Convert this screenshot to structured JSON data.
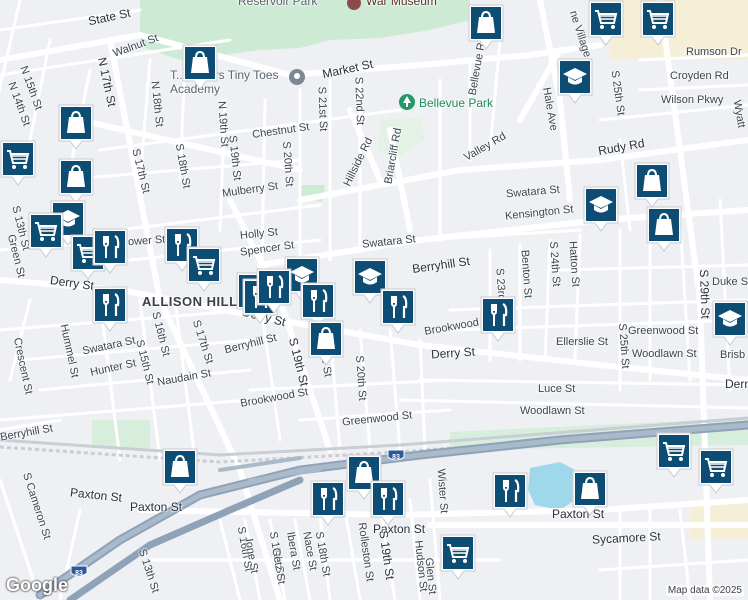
{
  "map": {
    "attribution": "Map data ©2025",
    "logo": "Google",
    "colors": {
      "land": "#eef0f3",
      "park": "#cdebd4",
      "water": "#9fd8ea",
      "sand": "#f6efd8",
      "road": "#ffffff",
      "highway": "#8fa2b8",
      "rail": "#c9cdd4",
      "marker": "#0e4d73"
    }
  },
  "labels": {
    "state_st": "State St",
    "walnut_st": "Walnut St",
    "n15th": "N 15th St",
    "n14th": "N 14th St",
    "n17th": "N 17th St",
    "n18th": "N 18th St",
    "n19th": "N 19th St",
    "market_st": "Market St",
    "s21st": "S 21st St",
    "s22nd": "S 22nd St",
    "chestnut_st": "Chestnut St",
    "hillside_rd": "Hillside Rd",
    "briarcliff_rd": "Briarcliff Rd",
    "bellevue_rd": "Bellevue Rd",
    "bellevue_park": "Bellevue Park",
    "valley_rd": "Valley Rd",
    "hale_ave": "Hale Ave",
    "rudy_rd": "Rudy Rd",
    "rumson_dr": "Rumson Dr",
    "croyden_rd": "Croyden Rd",
    "wilson_pkwy": "Wilson Pkwy",
    "s25th": "S 25th St",
    "village": "ne Village",
    "wyatt": "Wyatt",
    "s17th": "S 17th St",
    "s18th": "S 18th St",
    "s19th": "S 19th St",
    "s20th": "S 20th St",
    "mulberry_st": "Mulberry St",
    "swatara_st_ne": "Swatara St",
    "kensington_st": "Kensington St",
    "holly_st": "Holly St",
    "spencer_st": "Spencer St",
    "swatara_st_mid": "Swatara St",
    "berryhill_st": "Berryhill St",
    "s23rd": "S 23rd St",
    "benton_st": "Benton St",
    "hatton_st": "Hatton St",
    "s24th": "S 24th St",
    "s29th": "S 29th St",
    "duke_st": "Duke St",
    "allison_hill": "ALLISON HILL",
    "derry_st_w": "Derry St",
    "derry_st_mid": "Derry St",
    "derry_st_e": "Derry St",
    "s13th": "S 13th St",
    "green_st": "Green St",
    "s13th_b": "S 13th St",
    "s16th": "S 16th St",
    "s17th_b": "S 17th St",
    "s19th_b": "S 19th St",
    "s20th_b": "S 20th St",
    "kittatinny": "Kittatinny St",
    "berryhill_st_w": "Berryhill St",
    "brookwood_st": "Brookwood St",
    "brookwood_st_e": "Brookwood St",
    "greenwood_st": "Greenwood St",
    "greenwood_st_e": "Greenwood St",
    "woodlawn_st": "Woodlawn St",
    "woodlawn_st_e": "Woodlawn St",
    "ellerslie_st": "Ellerslie St",
    "luce_st": "Luce St",
    "brisb": "Brisb",
    "dern": "Dern",
    "swatara_st_w": "Swatara St",
    "hunter_st": "Hunter St",
    "s15th": "S 15th St",
    "naudain_st": "Naudain St",
    "hummel": "Hummel St",
    "crescent": "Crescent St",
    "berryhill_far": "Berryhill St",
    "s_cameron": "S Cameron St",
    "paxton_st_w": "Paxton St",
    "paxton_st_mid": "Paxton St",
    "paxton_st_mid2": "Paxton St",
    "paxton_st_e": "Paxton St",
    "sycamore_st": "Sycamore St",
    "s13th_c": "S 13th St",
    "s16th_b": "S 16th St",
    "ione_st": "Ione St",
    "s17th_c": "S 17th St",
    "getz": "Getz St",
    "ibera": "Ibera St",
    "nace": "Nace St",
    "s18th_b": "S 18th St",
    "rolleston": "Rolleston St",
    "s19th_c": "S 19th St",
    "hudson": "Hudson St",
    "glen": "Glen St",
    "wister": "Wister St",
    "lower": "ower St",
    "ie_st": "ie St",
    "s25th_b": "S 25th St",
    "reservoir_park": "Reservoir Park",
    "war_museum": "War Museum",
    "tiny_tots": "T.. Rogers Tiny Toes Academy",
    "rt83": "83",
    "rt83b": "83"
  },
  "markers": [
    {
      "icon": "shopping-bag-icon",
      "kind": "shopping"
    },
    {
      "icon": "shopping-bag-icon",
      "kind": "shopping"
    },
    {
      "icon": "shopping-cart-icon",
      "kind": "grocery"
    },
    {
      "icon": "shopping-bag-icon",
      "kind": "shopping"
    },
    {
      "icon": "graduation-cap-icon",
      "kind": "school"
    },
    {
      "icon": "shopping-cart-icon",
      "kind": "grocery"
    },
    {
      "icon": "shopping-cart-icon",
      "kind": "grocery"
    },
    {
      "icon": "restaurant-icon",
      "kind": "restaurant"
    },
    {
      "icon": "restaurant-icon",
      "kind": "restaurant"
    },
    {
      "icon": "shopping-cart-icon",
      "kind": "grocery"
    },
    {
      "icon": "restaurant-icon",
      "kind": "restaurant"
    },
    {
      "icon": "graduation-cap-icon",
      "kind": "school"
    },
    {
      "icon": "restaurant-icon",
      "kind": "restaurant"
    },
    {
      "icon": "restaurant-icon",
      "kind": "restaurant"
    },
    {
      "icon": "restaurant-icon",
      "kind": "restaurant"
    },
    {
      "icon": "graduation-cap-icon",
      "kind": "school"
    },
    {
      "icon": "restaurant-icon",
      "kind": "restaurant"
    },
    {
      "icon": "shopping-bag-icon",
      "kind": "shopping"
    },
    {
      "icon": "restaurant-icon",
      "kind": "restaurant"
    },
    {
      "icon": "graduation-cap-icon",
      "kind": "school"
    },
    {
      "icon": "graduation-cap-icon",
      "kind": "school"
    },
    {
      "icon": "shopping-bag-icon",
      "kind": "shopping"
    },
    {
      "icon": "shopping-bag-icon",
      "kind": "shopping"
    },
    {
      "icon": "graduation-cap-icon",
      "kind": "school"
    },
    {
      "icon": "shopping-cart-icon",
      "kind": "grocery"
    },
    {
      "icon": "shopping-bag-icon",
      "kind": "shopping"
    },
    {
      "icon": "shopping-cart-icon",
      "kind": "grocery"
    },
    {
      "icon": "shopping-bag-icon",
      "kind": "shopping"
    },
    {
      "icon": "restaurant-icon",
      "kind": "restaurant"
    },
    {
      "icon": "restaurant-icon",
      "kind": "restaurant"
    },
    {
      "icon": "restaurant-icon",
      "kind": "restaurant"
    },
    {
      "icon": "shopping-bag-icon",
      "kind": "shopping"
    },
    {
      "icon": "restaurant-icon",
      "kind": "restaurant"
    },
    {
      "icon": "shopping-bag-icon",
      "kind": "shopping"
    },
    {
      "icon": "shopping-cart-icon",
      "kind": "grocery"
    },
    {
      "icon": "shopping-cart-icon",
      "kind": "grocery"
    },
    {
      "icon": "shopping-cart-icon",
      "kind": "grocery"
    },
    {
      "icon": "shopping-cart-icon",
      "kind": "grocery"
    }
  ]
}
